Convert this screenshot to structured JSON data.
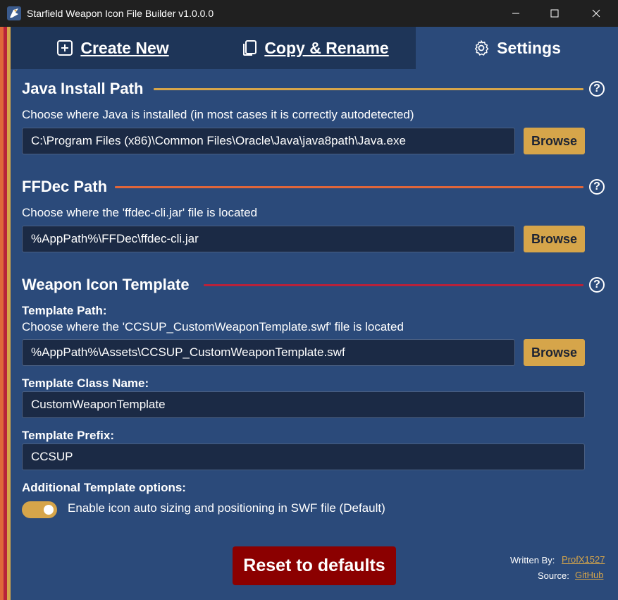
{
  "window": {
    "title": "Starfield Weapon Icon File Builder v1.0.0.0"
  },
  "tabs": [
    {
      "label": "Create New",
      "icon": "plus-square-icon"
    },
    {
      "label": "Copy & Rename",
      "icon": "copy-icon"
    },
    {
      "label": "Settings",
      "icon": "gear-icon"
    }
  ],
  "java": {
    "title": "Java Install Path",
    "description": "Choose where Java is installed (in most cases it is correctly autodetected)",
    "path": "C:\\Program Files (x86)\\Common Files\\Oracle\\Java\\java8path\\Java.exe",
    "browse_label": "Browse",
    "help": "?"
  },
  "ffdec": {
    "title": "FFDec Path",
    "description": "Choose where the 'ffdec-cli.jar' file is located",
    "path": "%AppPath%\\FFDec\\ffdec-cli.jar",
    "browse_label": "Browse",
    "help": "?"
  },
  "template": {
    "title": "Weapon Icon Template",
    "help": "?",
    "path_label": "Template Path:",
    "path_description": "Choose where the 'CCSUP_CustomWeaponTemplate.swf' file is located",
    "path": "%AppPath%\\Assets\\CCSUP_CustomWeaponTemplate.swf",
    "browse_label": "Browse",
    "class_label": "Template Class Name:",
    "class_value": "CustomWeaponTemplate",
    "prefix_label": "Template Prefix:",
    "prefix_value": "CCSUP",
    "options_label": "Additional Template options:",
    "auto_size_label": "Enable icon auto sizing and positioning in SWF file (Default)",
    "auto_size_enabled": true
  },
  "reset_label": "Reset to defaults",
  "credits": {
    "written_by_label": "Written By:",
    "author": "ProfX1527",
    "source_label": "Source:",
    "source": "GitHub"
  },
  "colors": {
    "background": "#2b4a7a",
    "tab_inactive": "#1e3558",
    "accent_gold": "#d6a54a",
    "accent_orange": "#e0663a",
    "accent_red": "#b8223a",
    "reset_red": "#8b0000"
  }
}
